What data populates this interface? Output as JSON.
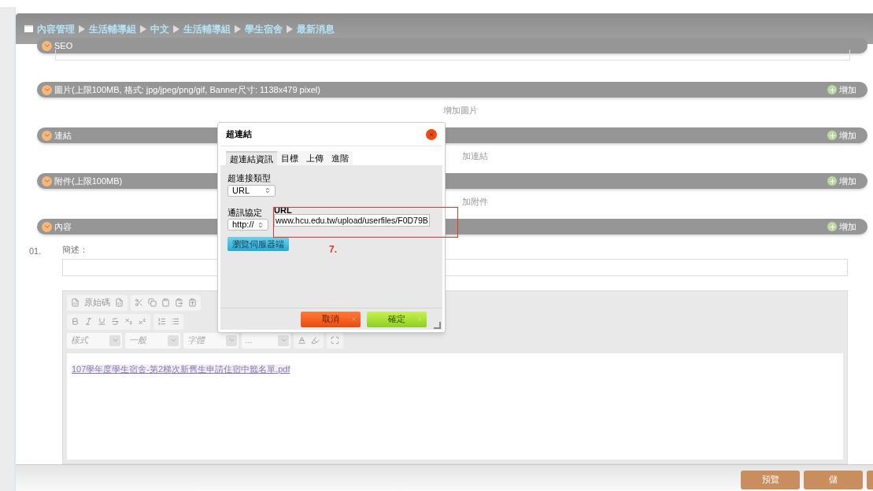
{
  "breadcrumb": [
    "內容管理",
    "生活輔導組",
    "中文",
    "生活輔導組",
    "學生宿舍",
    "最新消息"
  ],
  "sections": [
    {
      "title": "SEO",
      "kind": "field"
    },
    {
      "title": "圖片(上限100MB, 格式: jpg/jpeg/png/gif, Banner尺寸: 1138x479 pixel)",
      "kind": "list",
      "add_label": "增加",
      "hint": "增加圖片"
    },
    {
      "title": "連結",
      "kind": "list",
      "add_label": "增加",
      "hint": "加連結"
    },
    {
      "title": "附件(上限100MB)",
      "kind": "list",
      "add_label": "增加",
      "hint": "加附件"
    },
    {
      "title": "內容",
      "kind": "content",
      "add_label": "增加"
    }
  ],
  "content": {
    "index": "01.",
    "summary_label": "簡述：",
    "editor": {
      "source_label": "原始碼",
      "dropdowns": [
        {
          "label": "樣式"
        },
        {
          "label": "一般"
        },
        {
          "label": "字體"
        },
        {
          "label": "..."
        }
      ],
      "body_link": "107學年度學生宿舍-第2梯次新舊生申請住宿中籤名單.pdf"
    }
  },
  "actions": [
    {
      "label": "預覽"
    },
    {
      "label": "儲"
    }
  ],
  "partial_button_at_edge": true,
  "dialog": {
    "title": "超連結",
    "tabs": [
      {
        "label": "超連結資訊",
        "selected": true
      },
      {
        "label": "目標",
        "selected": false
      },
      {
        "label": "上傳",
        "selected": false
      },
      {
        "label": "進階",
        "selected": false
      }
    ],
    "link_type_label": "超連接類型",
    "link_type": "URL",
    "protocol_label": "通訊協定",
    "protocol": "http://",
    "url_label": "URL",
    "url": "www.hcu.edu.tw/upload/userfiles/F0D79B",
    "browse": "瀏覽伺服器端",
    "cancel": "取消",
    "ok": "確定"
  },
  "annotation": {
    "label": "7."
  }
}
